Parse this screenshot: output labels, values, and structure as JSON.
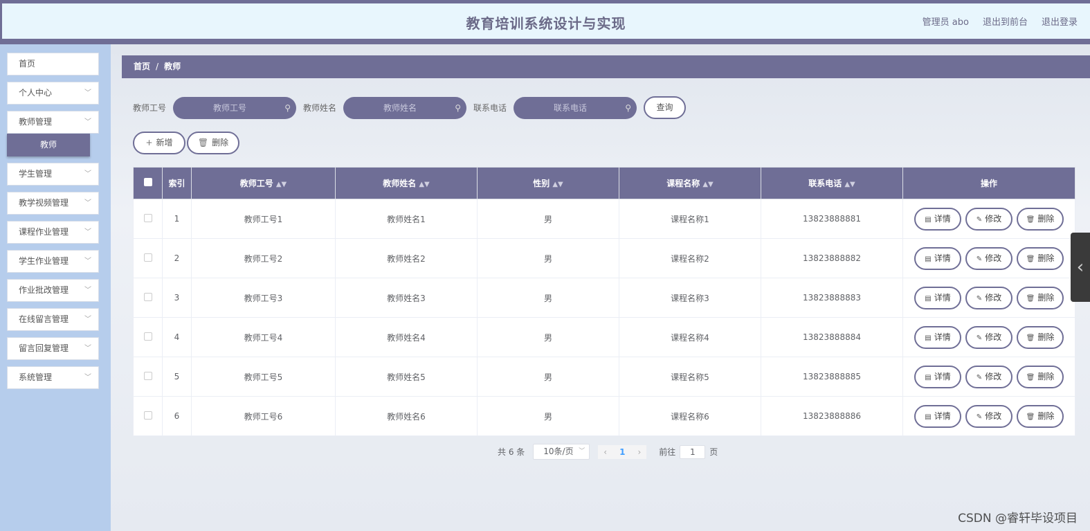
{
  "header": {
    "title": "教育培训系统设计与实现",
    "links": [
      "管理员 abo",
      "退出到前台",
      "退出登录"
    ]
  },
  "sidebar": {
    "items": [
      {
        "label": "首页",
        "expandable": false
      },
      {
        "label": "个人中心",
        "expandable": true
      },
      {
        "label": "教师管理",
        "expandable": true,
        "sub": "教师"
      },
      {
        "label": "学生管理",
        "expandable": true
      },
      {
        "label": "教学视频管理",
        "expandable": true
      },
      {
        "label": "课程作业管理",
        "expandable": true
      },
      {
        "label": "学生作业管理",
        "expandable": true
      },
      {
        "label": "作业批改管理",
        "expandable": true
      },
      {
        "label": "在线留言管理",
        "expandable": true
      },
      {
        "label": "留言回复管理",
        "expandable": true
      },
      {
        "label": "系统管理",
        "expandable": true
      }
    ]
  },
  "breadcrumb": {
    "home": "首页",
    "separator": "/",
    "current": "教师"
  },
  "search": {
    "fields": [
      {
        "label": "教师工号",
        "placeholder": "教师工号"
      },
      {
        "label": "教师姓名",
        "placeholder": "教师姓名"
      },
      {
        "label": "联系电话",
        "placeholder": "联系电话"
      }
    ],
    "query_label": "查询"
  },
  "actions": {
    "add_label": "新增",
    "delete_label": "删除"
  },
  "table": {
    "headers": [
      "索引",
      "教师工号",
      "教师姓名",
      "性别",
      "课程名称",
      "联系电话",
      "操作"
    ],
    "rows": [
      [
        "1",
        "教师工号1",
        "教师姓名1",
        "男",
        "课程名称1",
        "13823888881"
      ],
      [
        "2",
        "教师工号2",
        "教师姓名2",
        "男",
        "课程名称2",
        "13823888882"
      ],
      [
        "3",
        "教师工号3",
        "教师姓名3",
        "男",
        "课程名称3",
        "13823888883"
      ],
      [
        "4",
        "教师工号4",
        "教师姓名4",
        "男",
        "课程名称4",
        "13823888884"
      ],
      [
        "5",
        "教师工号5",
        "教师姓名5",
        "男",
        "课程名称5",
        "13823888885"
      ],
      [
        "6",
        "教师工号6",
        "教师姓名6",
        "男",
        "课程名称6",
        "13823888886"
      ]
    ],
    "row_actions": {
      "detail": "详情",
      "edit": "修改",
      "delete": "删除"
    }
  },
  "pagination": {
    "total": "共 6 条",
    "page_size": "10条/页",
    "current_page": "1",
    "goto_prefix": "前往",
    "goto_value": "1",
    "goto_suffix": "页"
  },
  "watermark": "CSDN @睿轩毕设项目",
  "colors": {
    "accent": "#6f6e96",
    "sidebar_bg": "#b6cdec",
    "header_bg": "#e8f6fd"
  }
}
